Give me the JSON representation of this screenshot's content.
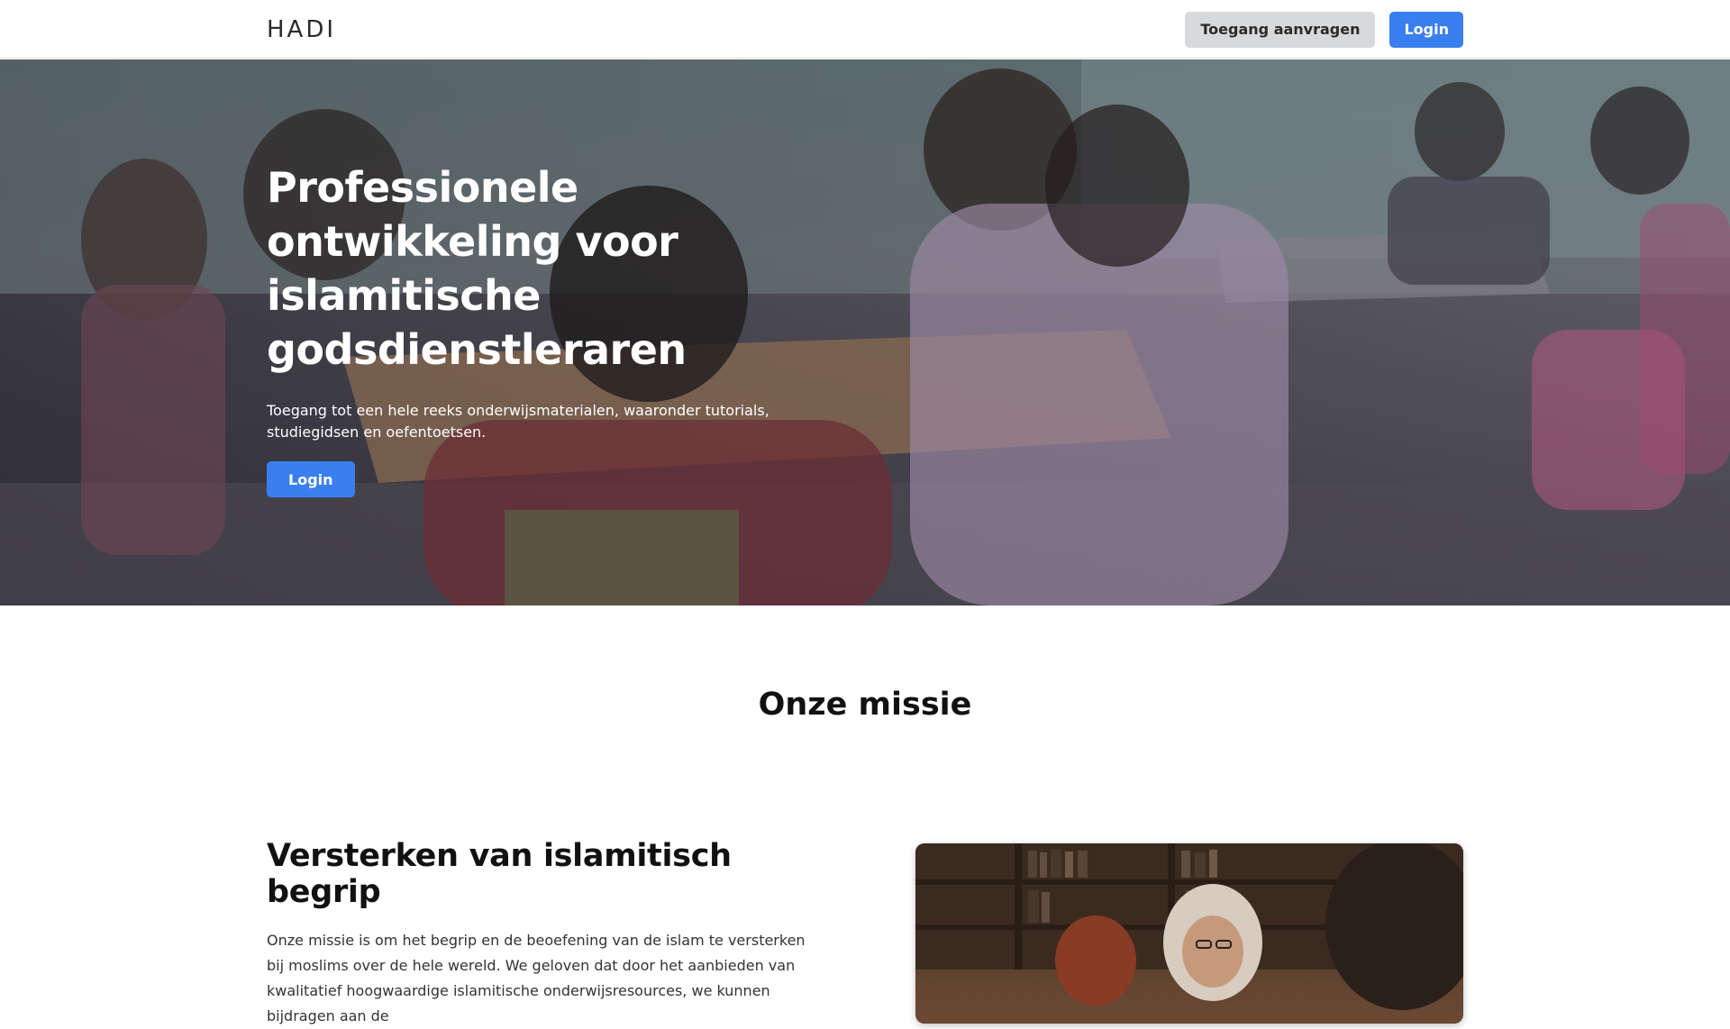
{
  "header": {
    "logo": "HADI",
    "request_access_label": "Toegang aanvragen",
    "login_label": "Login"
  },
  "hero": {
    "title": "Professionele ontwikkeling voor islamitische godsdienstleraren",
    "subtitle": "Toegang tot een hele reeks onderwijsmaterialen, waaronder tutorials, studiegidsen en oefentoetsen.",
    "login_label": "Login"
  },
  "mission": {
    "title": "Onze missie",
    "feature": {
      "title": "Versterken van islamitisch begrip",
      "text": "Onze missie is om het begrip en de beoefening van de islam te versterken bij moslims over de hele wereld. We geloven dat door het aanbieden van kwalitatief hoogwaardige islamitische onderwijsresources, we kunnen bijdragen aan de"
    }
  },
  "colors": {
    "primary": "#3a7ff0",
    "secondary_button": "#d8d9db"
  }
}
